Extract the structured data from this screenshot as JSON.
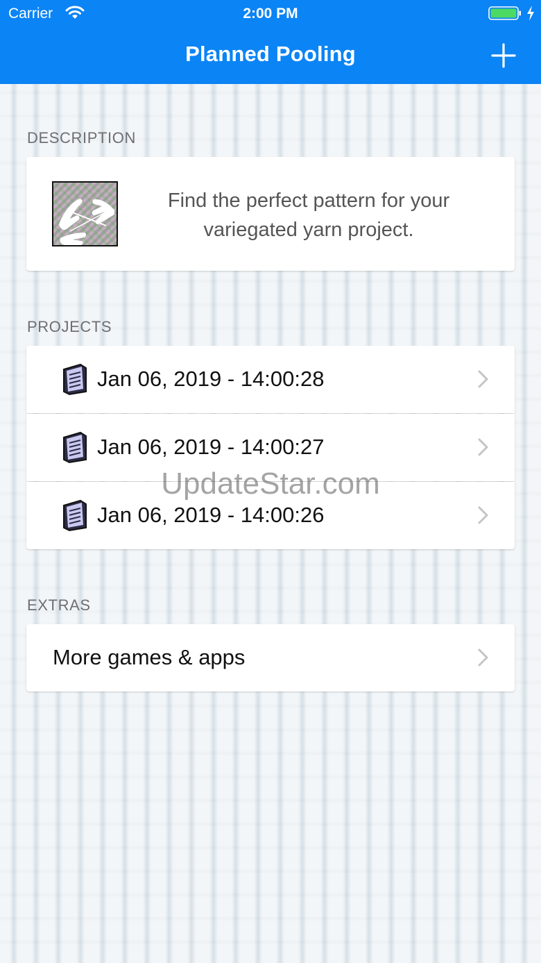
{
  "status_bar": {
    "carrier": "Carrier",
    "time": "2:00 PM"
  },
  "nav": {
    "title": "Planned Pooling",
    "add_icon": "plus-icon"
  },
  "description_section": {
    "header": "DESCRIPTION",
    "text": "Find the perfect pattern for your variegated yarn project."
  },
  "projects_section": {
    "header": "PROJECTS",
    "items": [
      {
        "label": "Jan 06, 2019 - 14:00:28",
        "icon": "document-icon"
      },
      {
        "label": "Jan 06, 2019 - 14:00:27",
        "icon": "document-icon"
      },
      {
        "label": "Jan 06, 2019 - 14:00:26",
        "icon": "document-icon"
      }
    ]
  },
  "extras_section": {
    "header": "EXTRAS",
    "items": [
      {
        "label": "More games & apps"
      }
    ]
  },
  "watermark": "UpdateStar.com",
  "colors": {
    "accent": "#0b84f5",
    "battery": "#4cd964"
  }
}
